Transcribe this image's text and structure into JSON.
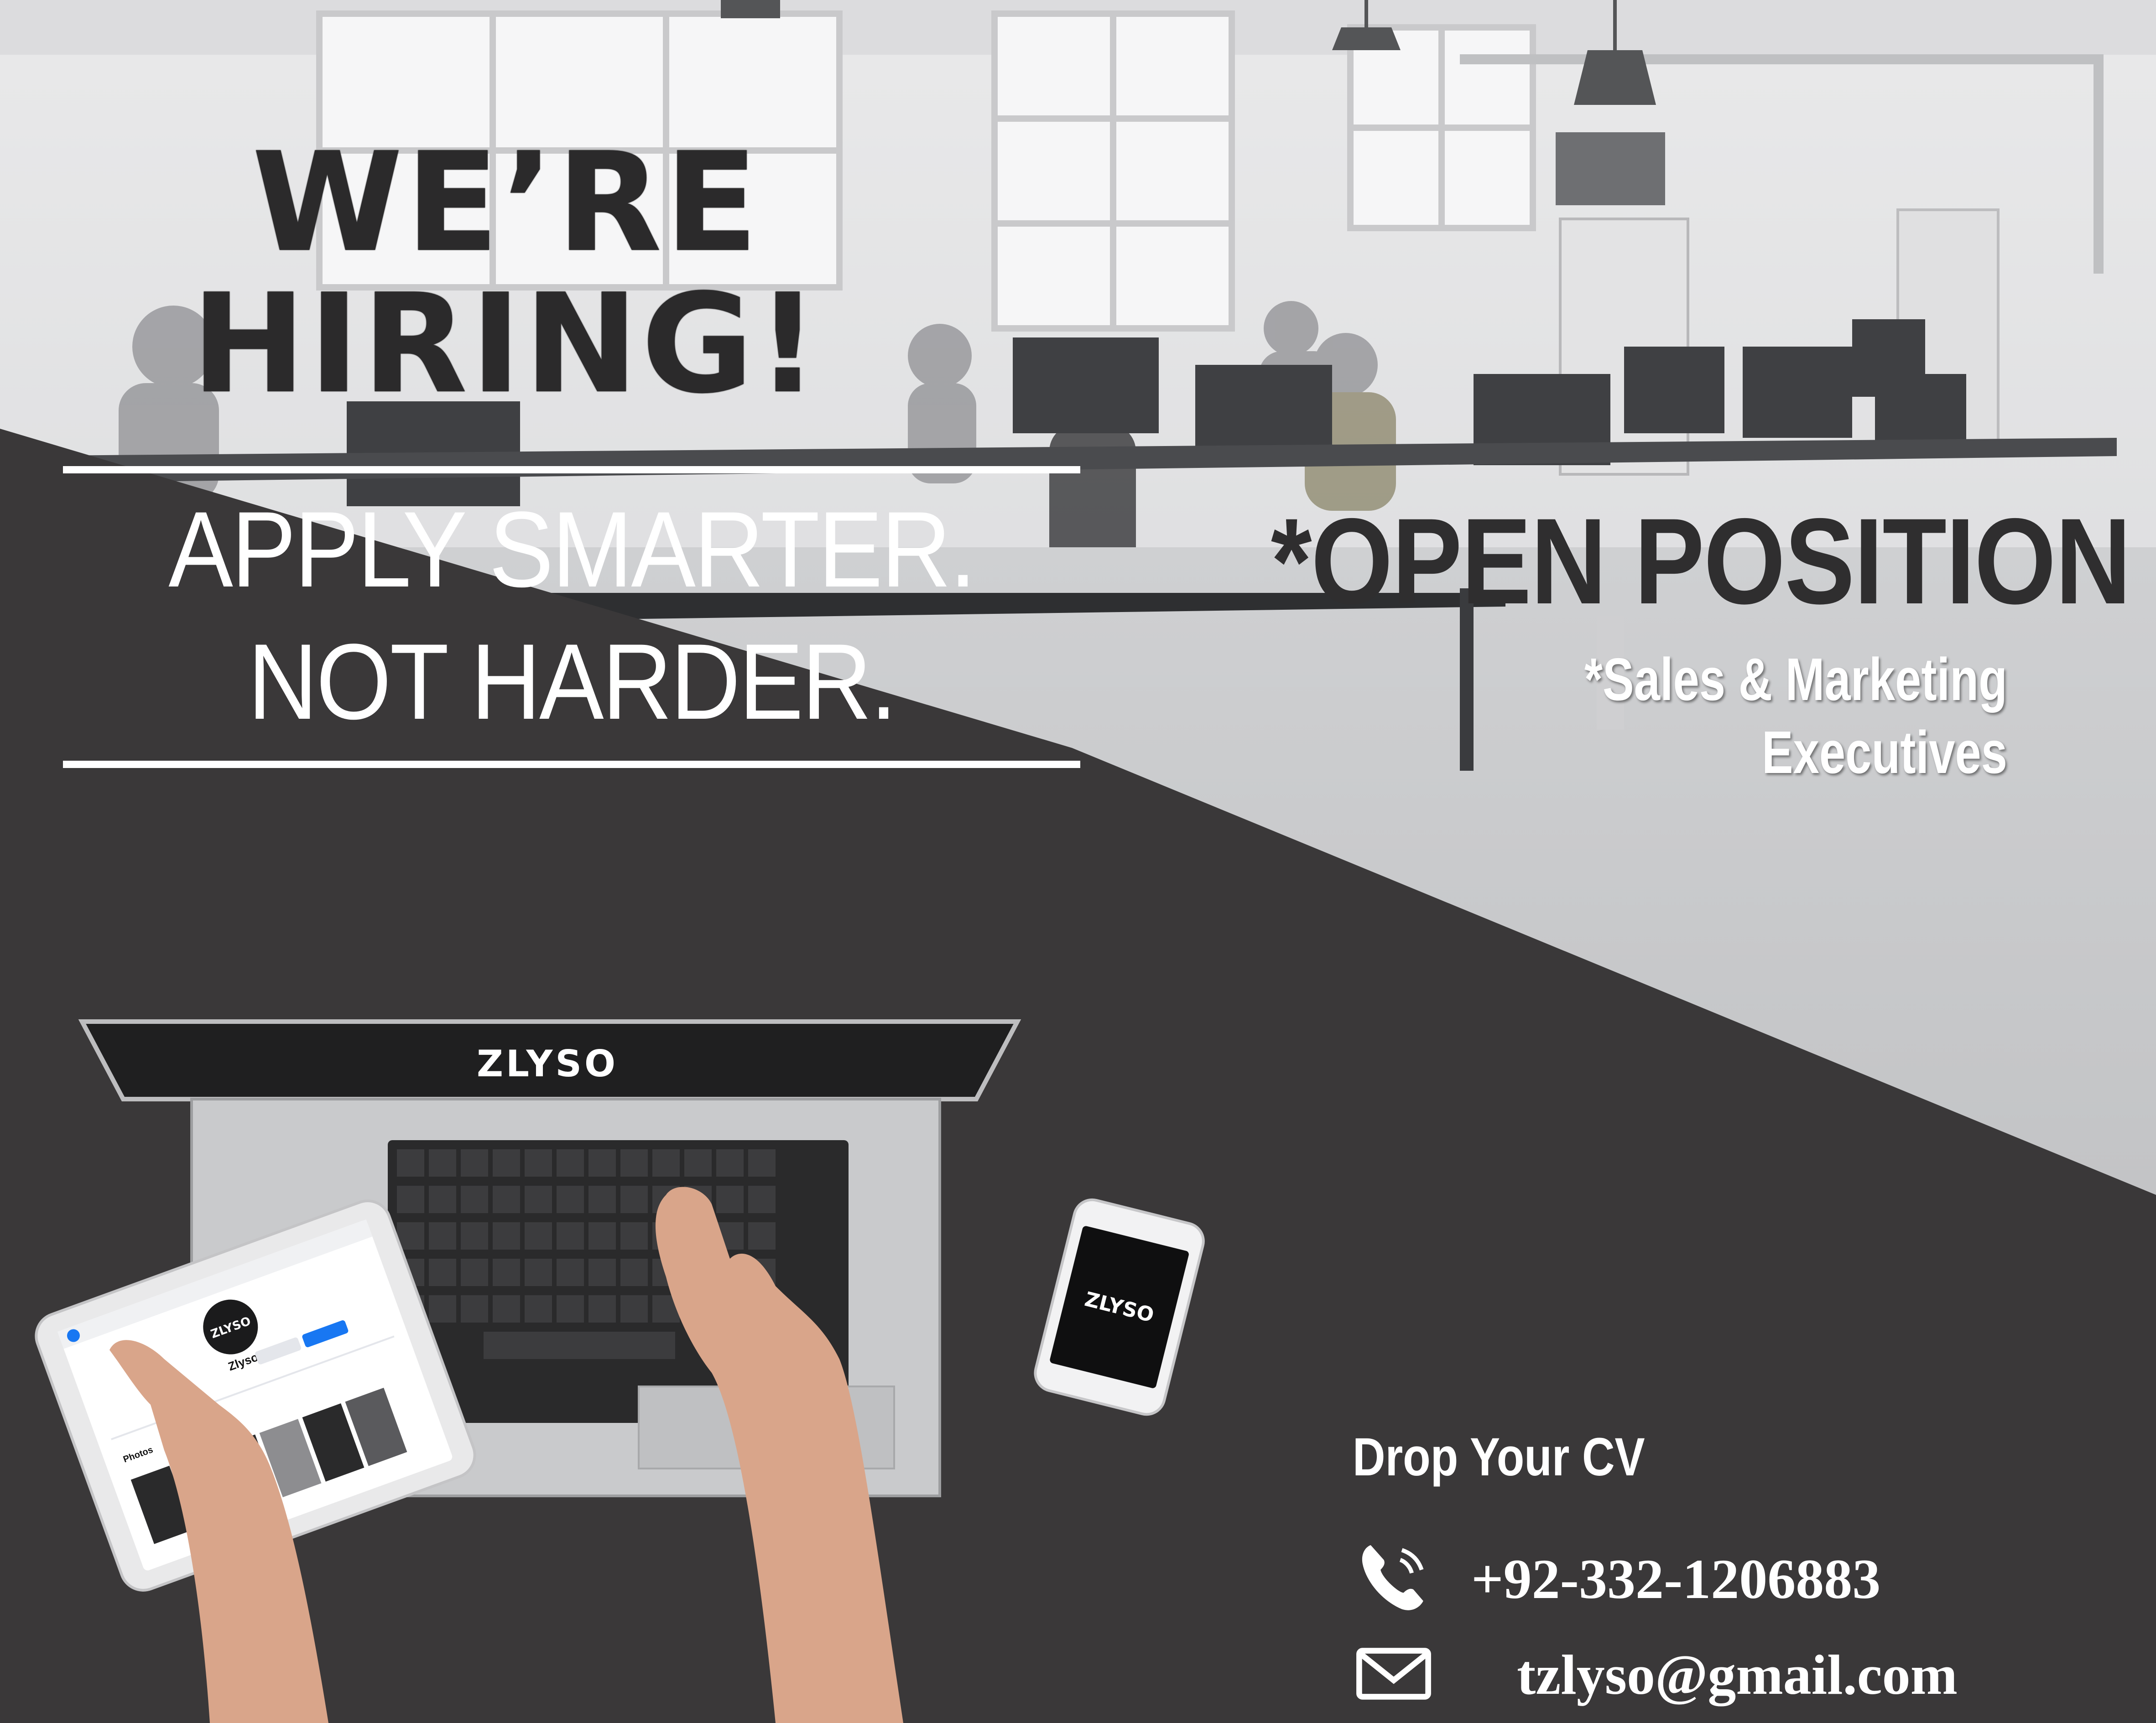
{
  "headline": {
    "line1": "WE’RE",
    "line2": "HIRING!"
  },
  "tagline": {
    "line1": "APPLY SMARTER.",
    "line2": "NOT HARDER."
  },
  "open_position": {
    "title": "*OPEN POSITION",
    "role": "*Sales & Marketing Executives"
  },
  "brand": {
    "logo": "ZLYSO",
    "tablet_page_name": "Zlyso",
    "tablet_tab_photos": "Photos",
    "icons": [
      "phone-icon",
      "mail-icon"
    ]
  },
  "contact": {
    "title": "Drop Your CV",
    "phone": "+92-332-1206883",
    "email": "tzlyso@gmail.com"
  },
  "colors": {
    "dark_panel": "#3a3839",
    "headline": "#2b2a2b",
    "accent_white": "#ffffff",
    "facebook_blue": "#1877f2"
  }
}
